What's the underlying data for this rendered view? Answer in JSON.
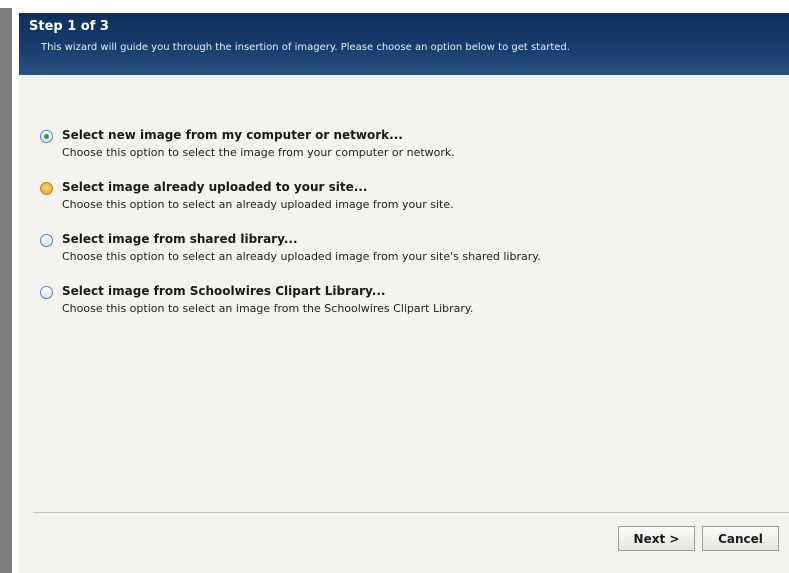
{
  "header": {
    "title": "Step 1 of 3",
    "subtitle": "This wizard will guide you through the insertion of imagery. Please choose an option below to get started."
  },
  "options": [
    {
      "label": "Select new image from my computer or network...",
      "description": "Choose this option to select the image from your computer or network.",
      "state": "selected"
    },
    {
      "label": "Select image already uploaded to your site...",
      "description": "Choose this option to select an already uploaded image from your site.",
      "state": "hover"
    },
    {
      "label": "Select image from shared library...",
      "description": "Choose this option to select an already uploaded image from your site's shared library.",
      "state": "unselected"
    },
    {
      "label": "Select image from Schoolwires Clipart Library...",
      "description": "Choose this option to select an image from the Schoolwires Clipart Library.",
      "state": "unselected"
    }
  ],
  "buttons": {
    "next_label": "Next >",
    "cancel_label": "Cancel"
  },
  "colors": {
    "header_bg": "#163c6d",
    "dialog_bg": "#f4f3f0",
    "selected_dot": "#3a9a3a",
    "hover_radio": "#e8b03c"
  }
}
